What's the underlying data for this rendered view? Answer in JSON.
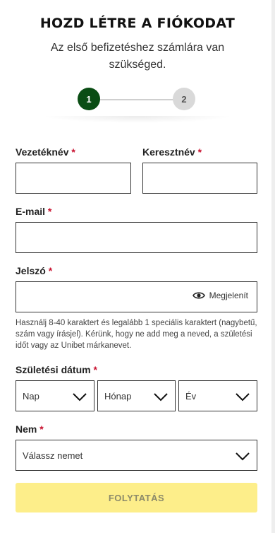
{
  "header": {
    "title": "HOZD LÉTRE A FIÓKODAT",
    "subtitle": "Az első befizetéshez számlára van szükséged."
  },
  "stepper": {
    "step1": "1",
    "step2": "2"
  },
  "form": {
    "required_mark": "*",
    "last_name": {
      "label": "Vezetéknév",
      "value": ""
    },
    "first_name": {
      "label": "Keresztnév",
      "value": ""
    },
    "email": {
      "label": "E-mail",
      "value": ""
    },
    "password": {
      "label": "Jelszó",
      "value": "",
      "show_label": "Megjelenít",
      "hint": "Használj 8-40 karaktert és legalább 1 speciális karaktert (nagybetű, szám vagy írásjel). Kérünk, hogy ne add meg a neved, a születési időt vagy az Unibet márkanevet."
    },
    "dob": {
      "label": "Születési dátum",
      "day": "Nap",
      "month": "Hónap",
      "year": "Év"
    },
    "gender": {
      "label": "Nem",
      "placeholder": "Válassz nemet"
    },
    "submit_label": "FOLYTATÁS"
  },
  "colors": {
    "step_active": "#0a4d14",
    "step_inactive": "#d9d9d9",
    "required": "#c8102e",
    "cta_disabled": "#fdee8a"
  }
}
